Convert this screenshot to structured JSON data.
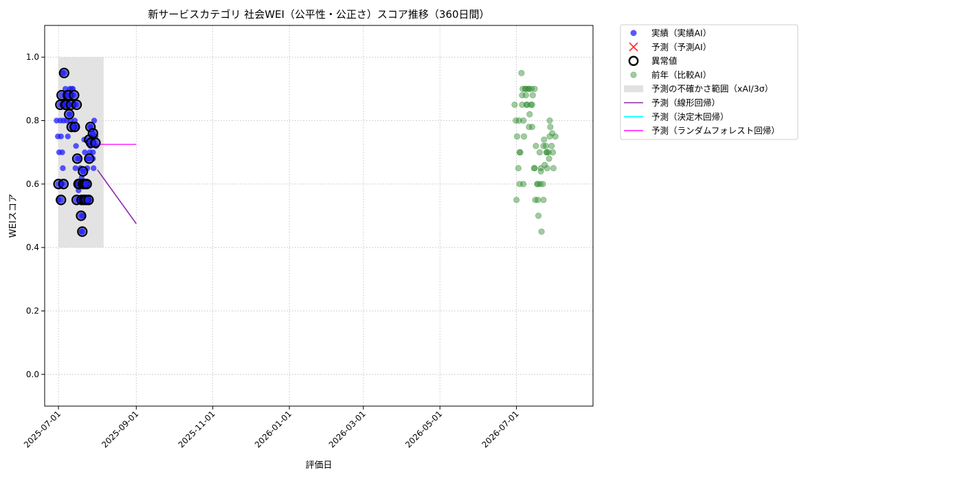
{
  "chart_data": {
    "type": "scatter",
    "title": "新サービスカテゴリ 社会WEI（公平性・公正さ）スコア推移（360日間）",
    "xlabel": "評価日",
    "ylabel": "WEIスコア",
    "xlim": [
      "2025-06-20",
      "2026-08-31"
    ],
    "ylim": [
      -0.1,
      1.1
    ],
    "grid": true,
    "legend_position": "outside-top-right",
    "x_ticks": [
      "2025-07-01",
      "2025-09-01",
      "2025-11-01",
      "2026-01-01",
      "2026-03-01",
      "2026-05-01",
      "2026-07-01"
    ],
    "y_ticks": [
      "0.0",
      "0.2",
      "0.4",
      "0.6",
      "0.8",
      "1.0"
    ],
    "colors": {
      "actual": "#1f1fff",
      "predicted": "#ff3333",
      "anomaly": "#000000",
      "previous": "#2e8b2e",
      "band": "#d9d9d9",
      "linear": "#8e24aa",
      "tree": "#00ffff",
      "forest": "#ff22ff"
    },
    "uncertainty_band": {
      "x": [
        "2025-07-01",
        "2025-08-06"
      ],
      "y": [
        0.4,
        1.0
      ]
    },
    "series": [
      {
        "name": "実績（実績AI）",
        "kind": "scatter",
        "points": [
          [
            "2025-07-01",
            0.8
          ],
          [
            "2025-07-01",
            0.75
          ],
          [
            "2025-07-02",
            0.8
          ],
          [
            "2025-07-02",
            0.6
          ],
          [
            "2025-07-02",
            0.55
          ],
          [
            "2025-07-03",
            0.75
          ],
          [
            "2025-07-03",
            0.85
          ],
          [
            "2025-07-03",
            0.7
          ],
          [
            "2025-07-04",
            0.6
          ],
          [
            "2025-07-04",
            0.65
          ],
          [
            "2025-07-05",
            0.88
          ],
          [
            "2025-07-05",
            0.7
          ],
          [
            "2025-07-05",
            0.8
          ],
          [
            "2025-07-06",
            0.85
          ],
          [
            "2025-07-06",
            0.95
          ],
          [
            "2025-07-07",
            0.9
          ],
          [
            "2025-07-07",
            0.8
          ],
          [
            "2025-07-07",
            0.75
          ],
          [
            "2025-07-08",
            0.88
          ],
          [
            "2025-07-08",
            0.85
          ],
          [
            "2025-07-09",
            0.9
          ],
          [
            "2025-07-09",
            0.85
          ],
          [
            "2025-07-10",
            0.88
          ],
          [
            "2025-07-10",
            0.8
          ],
          [
            "2025-07-11",
            0.9
          ],
          [
            "2025-07-11",
            0.82
          ],
          [
            "2025-07-12",
            0.85
          ],
          [
            "2025-07-12",
            0.78
          ],
          [
            "2025-07-13",
            0.9
          ],
          [
            "2025-07-13",
            0.88
          ],
          [
            "2025-07-14",
            0.85
          ],
          [
            "2025-07-14",
            0.78
          ],
          [
            "2025-07-15",
            0.8
          ],
          [
            "2025-07-15",
            0.72
          ],
          [
            "2025-07-16",
            0.68
          ],
          [
            "2025-07-16",
            0.65
          ],
          [
            "2025-07-17",
            0.6
          ],
          [
            "2025-07-17",
            0.55
          ],
          [
            "2025-07-18",
            0.62
          ],
          [
            "2025-07-18",
            0.58
          ],
          [
            "2025-07-19",
            0.6
          ],
          [
            "2025-07-19",
            0.5
          ],
          [
            "2025-07-20",
            0.65
          ],
          [
            "2025-07-20",
            0.45
          ],
          [
            "2025-07-21",
            0.6
          ],
          [
            "2025-07-21",
            0.55
          ],
          [
            "2025-07-22",
            0.64
          ],
          [
            "2025-07-22",
            0.7
          ],
          [
            "2025-07-23",
            0.6
          ],
          [
            "2025-07-23",
            0.74
          ],
          [
            "2025-07-24",
            0.55
          ],
          [
            "2025-07-24",
            0.68
          ],
          [
            "2025-07-25",
            0.72
          ],
          [
            "2025-07-25",
            0.65
          ],
          [
            "2025-07-26",
            0.7
          ],
          [
            "2025-07-26",
            0.73
          ],
          [
            "2025-07-27",
            0.55
          ],
          [
            "2025-07-27",
            0.78
          ],
          [
            "2025-07-28",
            0.68
          ],
          [
            "2025-07-28",
            0.8
          ],
          [
            "2025-07-29",
            0.76
          ],
          [
            "2025-07-29",
            0.65
          ],
          [
            "2025-07-30",
            0.72
          ],
          [
            "2025-07-30",
            0.7
          ],
          [
            "2025-07-31",
            0.75
          ]
        ]
      },
      {
        "name": "予測（予測AI）",
        "kind": "scatter",
        "points": []
      },
      {
        "name": "異常値",
        "kind": "scatter-outline",
        "points": [
          [
            "2025-07-01",
            0.85
          ],
          [
            "2025-07-02",
            0.6
          ],
          [
            "2025-07-03",
            0.55
          ],
          [
            "2025-07-04",
            0.6
          ],
          [
            "2025-07-05",
            0.88
          ],
          [
            "2025-07-06",
            0.95
          ],
          [
            "2025-07-06",
            0.85
          ],
          [
            "2025-07-07",
            0.88
          ],
          [
            "2025-07-08",
            0.85
          ],
          [
            "2025-07-09",
            0.88
          ],
          [
            "2025-07-10",
            0.85
          ],
          [
            "2025-07-11",
            0.82
          ],
          [
            "2025-07-12",
            0.78
          ],
          [
            "2025-07-13",
            0.88
          ],
          [
            "2025-07-14",
            0.85
          ],
          [
            "2025-07-15",
            0.78
          ],
          [
            "2025-07-16",
            0.68
          ],
          [
            "2025-07-16",
            0.6
          ],
          [
            "2025-07-17",
            0.55
          ],
          [
            "2025-07-18",
            0.6
          ],
          [
            "2025-07-19",
            0.55
          ],
          [
            "2025-07-19",
            0.6
          ],
          [
            "2025-07-20",
            0.5
          ],
          [
            "2025-07-20",
            0.45
          ],
          [
            "2025-07-21",
            0.6
          ],
          [
            "2025-07-22",
            0.64
          ],
          [
            "2025-07-22",
            0.55
          ],
          [
            "2025-07-23",
            0.6
          ],
          [
            "2025-07-24",
            0.74
          ],
          [
            "2025-07-24",
            0.55
          ],
          [
            "2025-07-25",
            0.55
          ],
          [
            "2025-07-26",
            0.73
          ],
          [
            "2025-07-27",
            0.68
          ],
          [
            "2025-07-27",
            0.78
          ],
          [
            "2025-07-28",
            0.76
          ],
          [
            "2025-07-29",
            0.73
          ]
        ]
      },
      {
        "name": "前年（比較AI）",
        "kind": "scatter-faded",
        "points": [
          [
            "2026-07-01",
            0.85
          ],
          [
            "2026-07-01",
            0.8
          ],
          [
            "2026-07-01",
            0.75
          ],
          [
            "2026-07-02",
            0.6
          ],
          [
            "2026-07-02",
            0.55
          ],
          [
            "2026-07-03",
            0.8
          ],
          [
            "2026-07-03",
            0.7
          ],
          [
            "2026-07-04",
            0.65
          ],
          [
            "2026-07-04",
            0.7
          ],
          [
            "2026-07-05",
            0.88
          ],
          [
            "2026-07-05",
            0.6
          ],
          [
            "2026-07-06",
            0.95
          ],
          [
            "2026-07-06",
            0.9
          ],
          [
            "2026-07-06",
            0.75
          ],
          [
            "2026-07-07",
            0.85
          ],
          [
            "2026-07-07",
            0.8
          ],
          [
            "2026-07-08",
            0.9
          ],
          [
            "2026-07-08",
            0.85
          ],
          [
            "2026-07-09",
            0.9
          ],
          [
            "2026-07-09",
            0.85
          ],
          [
            "2026-07-10",
            0.9
          ],
          [
            "2026-07-10",
            0.88
          ],
          [
            "2026-07-11",
            0.9
          ],
          [
            "2026-07-11",
            0.82
          ],
          [
            "2026-07-12",
            0.85
          ],
          [
            "2026-07-12",
            0.78
          ],
          [
            "2026-07-13",
            0.9
          ],
          [
            "2026-07-13",
            0.88
          ],
          [
            "2026-07-14",
            0.85
          ],
          [
            "2026-07-14",
            0.78
          ],
          [
            "2026-07-15",
            0.9
          ],
          [
            "2026-07-15",
            0.72
          ],
          [
            "2026-07-16",
            0.65
          ],
          [
            "2026-07-16",
            0.55
          ],
          [
            "2026-07-17",
            0.6
          ],
          [
            "2026-07-17",
            0.65
          ],
          [
            "2026-07-18",
            0.6
          ],
          [
            "2026-07-18",
            0.5
          ],
          [
            "2026-07-19",
            0.65
          ],
          [
            "2026-07-19",
            0.55
          ],
          [
            "2026-07-20",
            0.6
          ],
          [
            "2026-07-20",
            0.45
          ],
          [
            "2026-07-21",
            0.7
          ],
          [
            "2026-07-21",
            0.64
          ],
          [
            "2026-07-22",
            0.72
          ],
          [
            "2026-07-22",
            0.66
          ],
          [
            "2026-07-23",
            0.6
          ],
          [
            "2026-07-23",
            0.74
          ],
          [
            "2026-07-24",
            0.7
          ],
          [
            "2026-07-24",
            0.55
          ],
          [
            "2026-07-25",
            0.72
          ],
          [
            "2026-07-25",
            0.65
          ],
          [
            "2026-07-26",
            0.75
          ],
          [
            "2026-07-26",
            0.7
          ],
          [
            "2026-07-27",
            0.68
          ],
          [
            "2026-07-27",
            0.78
          ],
          [
            "2026-07-28",
            0.7
          ],
          [
            "2026-07-28",
            0.8
          ],
          [
            "2026-07-29",
            0.76
          ],
          [
            "2026-07-29",
            0.65
          ],
          [
            "2026-07-30",
            0.72
          ],
          [
            "2026-07-30",
            0.7
          ],
          [
            "2026-07-31",
            0.75
          ]
        ]
      },
      {
        "name": "予測の不確かさ範囲（xAI/3σ）",
        "kind": "band"
      },
      {
        "name": "予測（線形回帰）",
        "kind": "line",
        "points": [
          [
            "2025-08-01",
            0.645
          ],
          [
            "2025-09-01",
            0.475
          ]
        ]
      },
      {
        "name": "予測（決定木回帰）",
        "kind": "line",
        "points": []
      },
      {
        "name": "予測（ランダムフォレスト回帰）",
        "kind": "line",
        "points": [
          [
            "2025-08-01",
            0.725
          ],
          [
            "2025-09-01",
            0.725
          ]
        ]
      }
    ]
  }
}
